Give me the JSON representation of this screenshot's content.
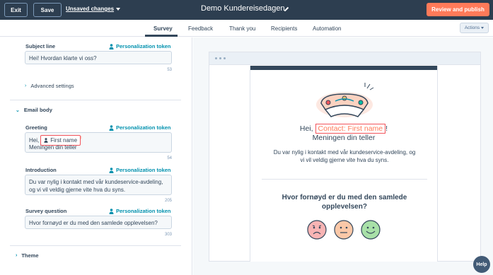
{
  "topbar": {
    "exit_label": "Exit",
    "save_label": "Save",
    "unsaved_label": "Unsaved changes",
    "title": "Demo Kundereisedagen",
    "publish_label": "Review and publish"
  },
  "tabs": [
    {
      "label": "Survey",
      "active": true
    },
    {
      "label": "Feedback"
    },
    {
      "label": "Thank you"
    },
    {
      "label": "Recipients"
    },
    {
      "label": "Automation"
    }
  ],
  "actions_label": "Actions",
  "editor": {
    "subject": {
      "label": "Subject line",
      "token_label": "Personalization token",
      "value": "Hei! Hvordan klarte vi oss?",
      "count": "53"
    },
    "advanced_label": "Advanced settings",
    "email_body_label": "Email body",
    "greeting": {
      "label": "Greeting",
      "token_label": "Personalization token",
      "prefix": "Hei,",
      "token": "First name",
      "suffix": "!",
      "line2": "Meningen din teller",
      "count": "54"
    },
    "introduction": {
      "label": "Introduction",
      "token_label": "Personalization token",
      "value": "Du var nylig i kontakt med vår kundeservice-avdeling, og vi vil veldig gjerne vite hva du syns.",
      "count": "205"
    },
    "survey_question": {
      "label": "Survey question",
      "token_label": "Personalization token",
      "value": "Hvor fornøyd er du med den samlede opplevelsen?",
      "count": "303"
    },
    "theme_label": "Theme"
  },
  "preview": {
    "greeting_prefix": "Hei,",
    "token": "Contact: First name",
    "greeting_suffix": "!",
    "signoff": "Meningen din teller",
    "intro": "Du var nylig i kontakt med vår kundeservice-avdeling, og vi vil veldig gjerne vite hva du syns.",
    "question": "Hvor fornøyd er du med den samlede opplevelsen?",
    "faces": [
      "sad-face-icon",
      "neutral-face-icon",
      "happy-face-icon"
    ]
  },
  "help_label": "Help",
  "colors": {
    "topbar": "#2d3e50",
    "accent": "#ff7a59",
    "link": "#0091ae",
    "token_border": "#f2545b",
    "sad": "#f8b4b4",
    "neutral": "#fbc8a8",
    "happy": "#a8e0a8"
  }
}
